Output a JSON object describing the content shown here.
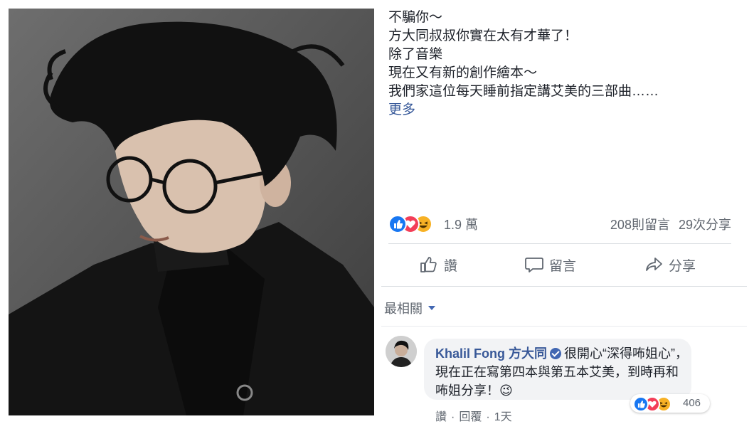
{
  "post": {
    "caption_lines": [
      "不騙你～",
      "方大同叔叔你實在太有才華了！",
      "除了音樂",
      "現在又有新的創作繪本～",
      "我們家這位每天睡前指定講艾美的三部曲……"
    ],
    "more_label": "更多",
    "reaction_icons": [
      "like-icon",
      "love-icon",
      "haha-icon"
    ],
    "reaction_count": "1.9 萬",
    "comments_count": "208則留言",
    "shares_count": "29次分享"
  },
  "actions": {
    "like_label": "讚",
    "comment_label": "留言",
    "share_label": "分享"
  },
  "sort": {
    "label": "最相關"
  },
  "comment": {
    "author": "Khalil Fong 方大同",
    "text": "很開心“深得咘姐心”，現在正在寫第四本與第五本艾美，到時再和咘姐分享！😉",
    "reaction_icons": [
      "like-icon",
      "love-icon",
      "haha-icon"
    ],
    "reaction_count": "406",
    "like_label": "讚",
    "reply_label": "回覆",
    "time": "1天"
  },
  "colors": {
    "link": "#365899",
    "like": "#1877f2",
    "love": "#f33e58",
    "haha": "#f7b125",
    "text_secondary": "#606770"
  }
}
